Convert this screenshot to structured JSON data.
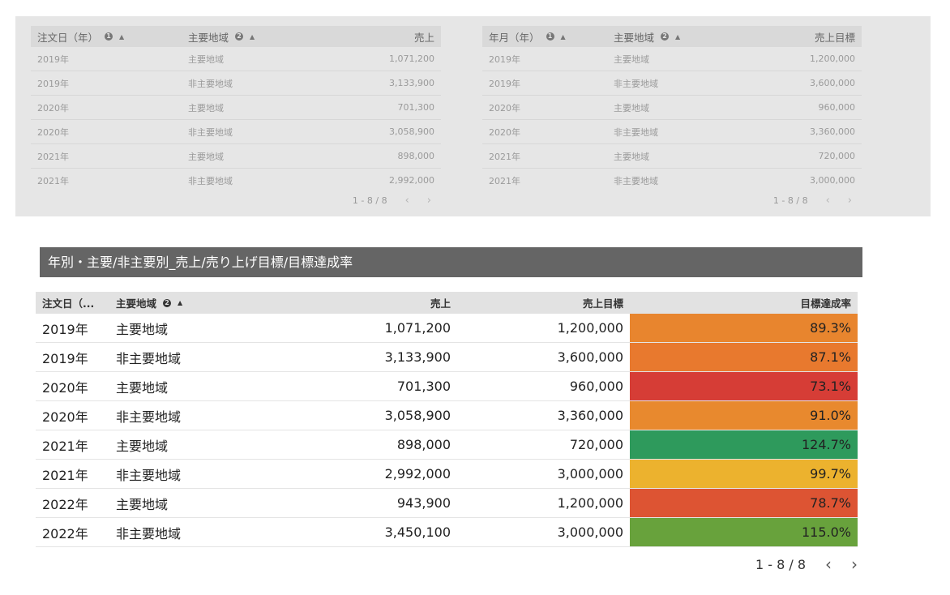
{
  "table_a": {
    "headers": [
      "注文日（年）",
      "主要地域",
      "売上"
    ],
    "rows": [
      [
        "2019年",
        "主要地域",
        "1,071,200"
      ],
      [
        "2019年",
        "非主要地域",
        "3,133,900"
      ],
      [
        "2020年",
        "主要地域",
        "701,300"
      ],
      [
        "2020年",
        "非主要地域",
        "3,058,900"
      ],
      [
        "2021年",
        "主要地域",
        "898,000"
      ],
      [
        "2021年",
        "非主要地域",
        "2,992,000"
      ]
    ],
    "pager": "1 - 8 / 8"
  },
  "table_b": {
    "headers": [
      "年月（年）",
      "主要地域",
      "売上目標"
    ],
    "rows": [
      [
        "2019年",
        "主要地域",
        "1,200,000"
      ],
      [
        "2019年",
        "非主要地域",
        "3,600,000"
      ],
      [
        "2020年",
        "主要地域",
        "960,000"
      ],
      [
        "2020年",
        "非主要地域",
        "3,360,000"
      ],
      [
        "2021年",
        "主要地域",
        "720,000"
      ],
      [
        "2021年",
        "非主要地域",
        "3,000,000"
      ]
    ],
    "pager": "1 - 8 / 8"
  },
  "main_table": {
    "title": "年別・主要/非主要別_売上/売り上げ目標/目標達成率",
    "headers": [
      "注文日（...",
      "主要地域",
      "売上",
      "売上目標",
      "目標達成率"
    ],
    "rows": [
      [
        "2019年",
        "主要地域",
        "1,071,200",
        "1,200,000",
        "89.3%"
      ],
      [
        "2019年",
        "非主要地域",
        "3,133,900",
        "3,600,000",
        "87.1%"
      ],
      [
        "2020年",
        "主要地域",
        "701,300",
        "960,000",
        "73.1%"
      ],
      [
        "2020年",
        "非主要地域",
        "3,058,900",
        "3,360,000",
        "91.0%"
      ],
      [
        "2021年",
        "主要地域",
        "898,000",
        "720,000",
        "124.7%"
      ],
      [
        "2021年",
        "非主要地域",
        "2,992,000",
        "3,000,000",
        "99.7%"
      ],
      [
        "2022年",
        "主要地域",
        "943,900",
        "1,200,000",
        "78.7%"
      ],
      [
        "2022年",
        "非主要地域",
        "3,450,100",
        "3,000,000",
        "115.0%"
      ]
    ],
    "rate_colors": [
      "#e8852e",
      "#e8792e",
      "#d63d36",
      "#e8892e",
      "#2e9a5c",
      "#ecb22e",
      "#dd5433",
      "#68a23c"
    ],
    "pager": "1 - 8 / 8"
  },
  "icons": {
    "info_badge_1": "❶",
    "info_badge_2": "❷",
    "sort_caret": "▲",
    "prev": "‹",
    "next": "›"
  }
}
